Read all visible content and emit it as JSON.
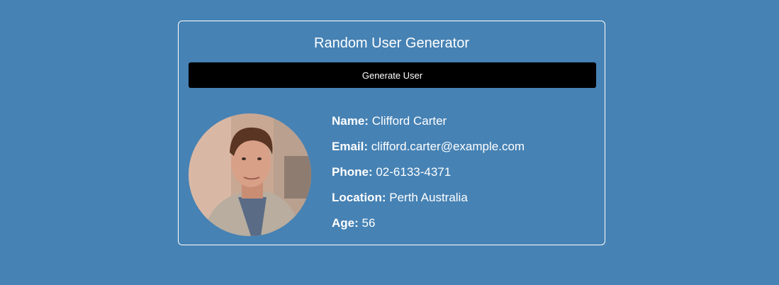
{
  "app": {
    "title": "Random User Generator",
    "generate_label": "Generate User"
  },
  "user": {
    "fields": [
      {
        "label": "Name:",
        "value": "Clifford Carter"
      },
      {
        "label": "Email:",
        "value": "clifford.carter@example.com"
      },
      {
        "label": "Phone:",
        "value": "02-6133-4371"
      },
      {
        "label": "Location:",
        "value": "Perth Australia"
      },
      {
        "label": "Age:",
        "value": "56"
      }
    ]
  },
  "colors": {
    "background": "#4682b4",
    "button": "#000000",
    "text": "#ffffff"
  }
}
